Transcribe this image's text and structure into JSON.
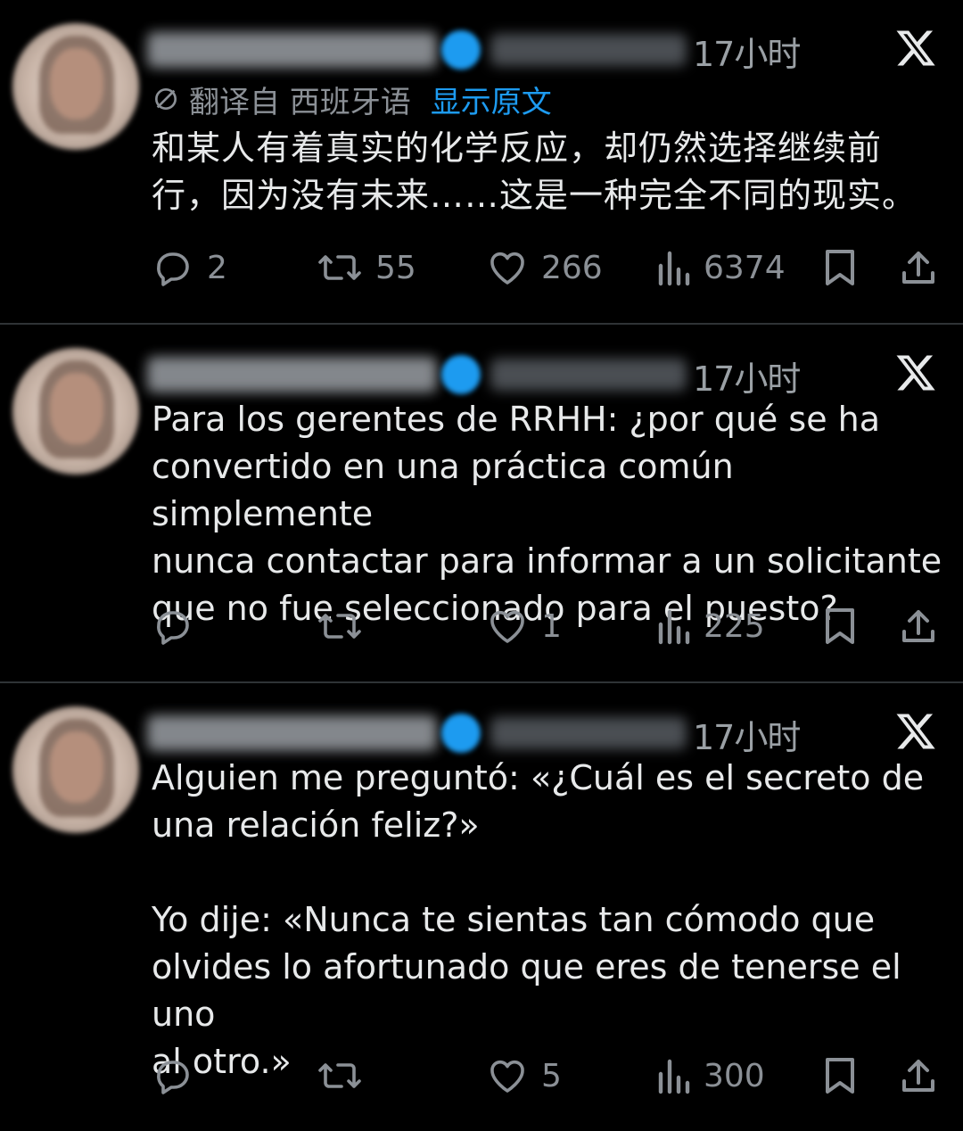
{
  "tweets": [
    {
      "time": "17小时",
      "translated": true,
      "translation": {
        "label": "翻译自 西班牙语",
        "show_original": "显示原文"
      },
      "text": "和某人有着真实的化学反应，却仍然选择继续前\n行，因为没有未来……这是一种完全不同的现实。",
      "counts": {
        "replies": "2",
        "retweets": "55",
        "likes": "266",
        "views": "6374"
      }
    },
    {
      "time": "17小时",
      "translated": false,
      "text": "Para los gerentes de RRHH: ¿por qué se ha\nconvertido en una práctica común simplemente\nnunca contactar para informar a un solicitante\nque no fue seleccionado para el puesto?",
      "counts": {
        "replies": "",
        "retweets": "",
        "likes": "1",
        "views": "225"
      }
    },
    {
      "time": "17小时",
      "translated": false,
      "text": "Alguien me preguntó: «¿Cuál es el secreto de\nuna relación feliz?»\n\nYo dije: «Nunca te sientas tan cómodo que\nolvides lo afortunado que eres de tenerse el uno\nal otro.»",
      "counts": {
        "replies": "",
        "retweets": "",
        "likes": "5",
        "views": "300"
      }
    }
  ],
  "colors": {
    "background": "#000000",
    "text": "#e7e9ea",
    "muted": "#8b9096",
    "link": "#1d9bf0",
    "divider": "#2f3336"
  },
  "icons": [
    "x-logo-icon",
    "translate-icon",
    "reply-icon",
    "retweet-icon",
    "like-icon",
    "views-icon",
    "bookmark-icon",
    "share-icon"
  ]
}
